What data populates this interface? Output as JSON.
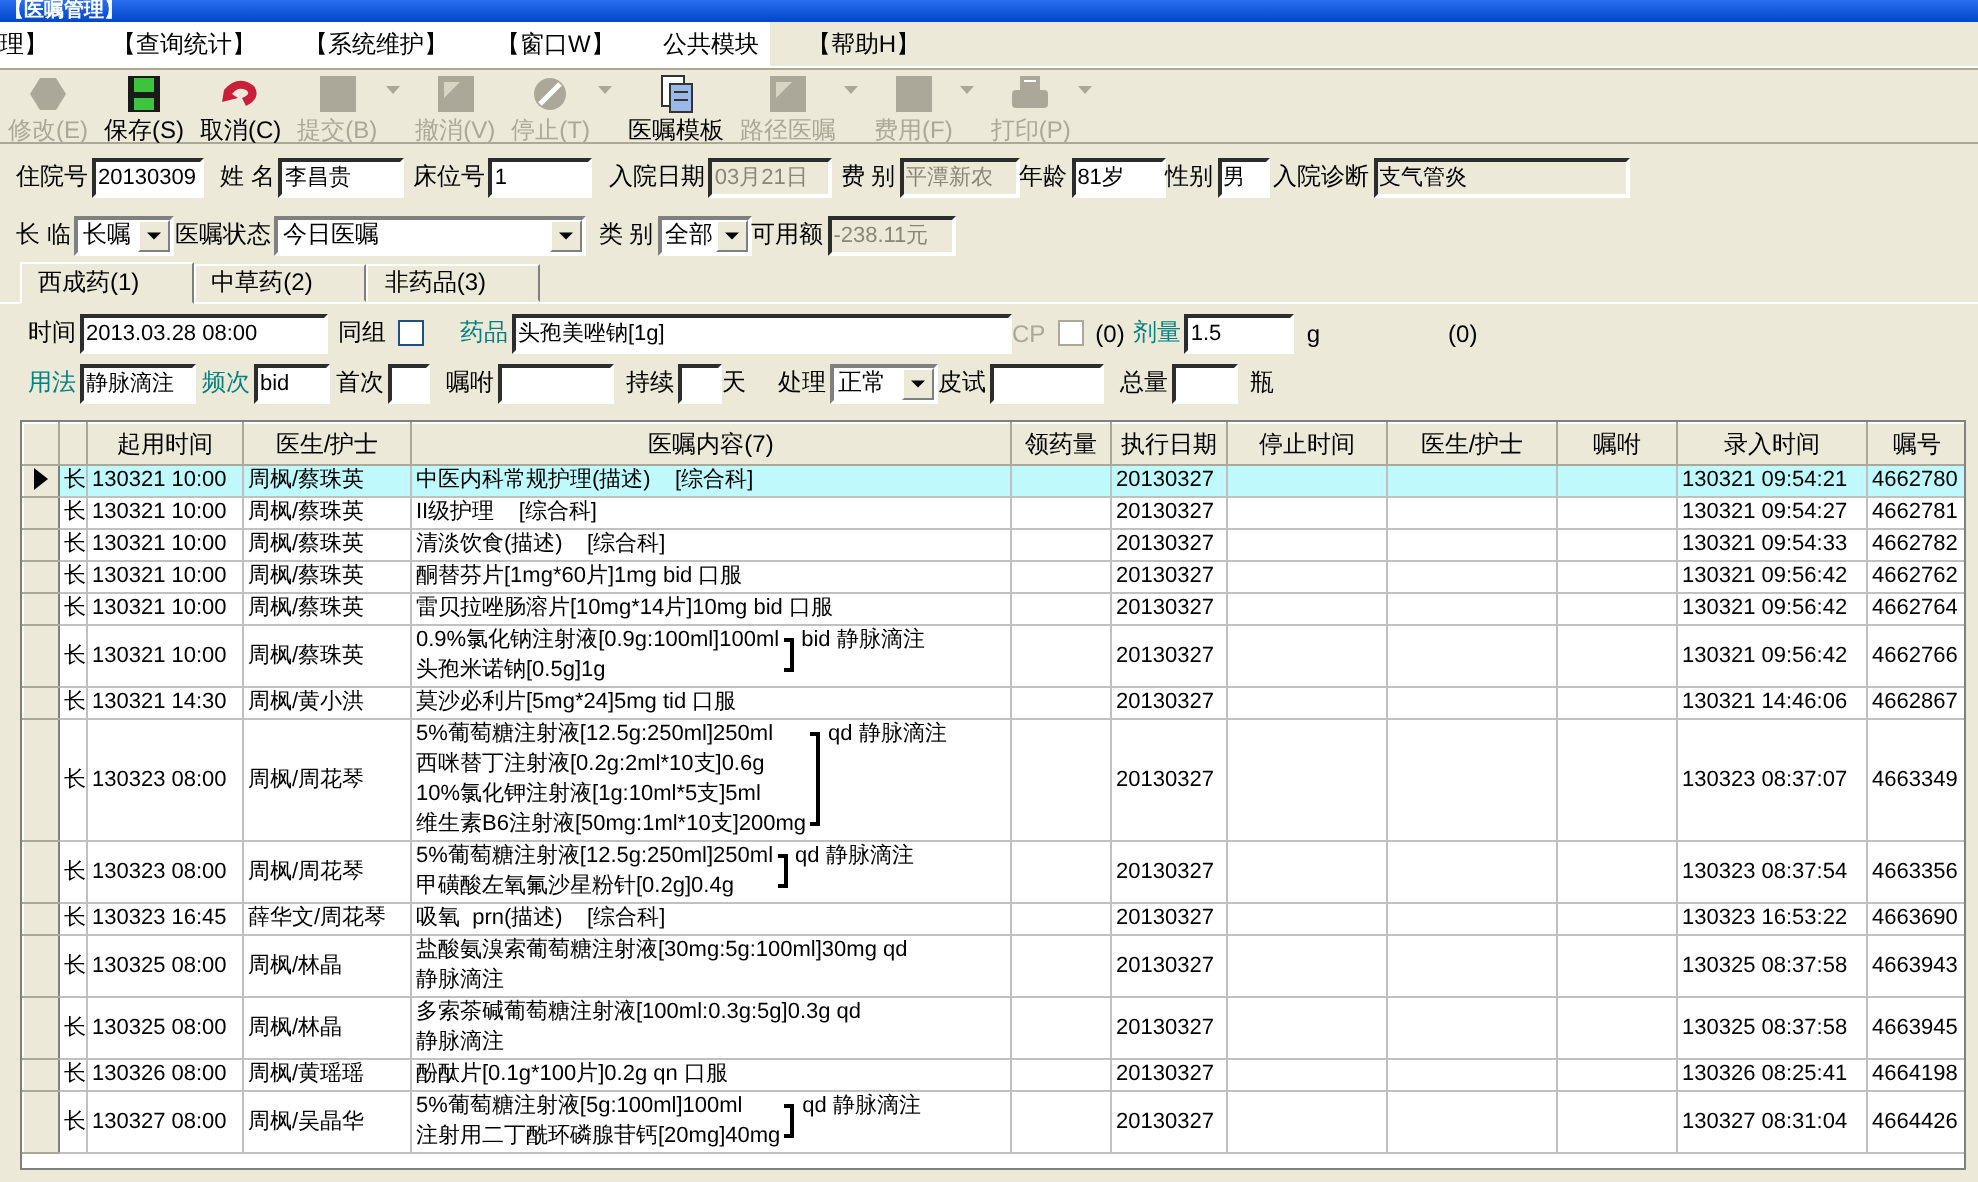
{
  "window": {
    "title": "【医嘱管理】"
  },
  "menu": [
    {
      "label": "理】"
    },
    {
      "label": "【查询统计】"
    },
    {
      "label": "【系统维护】"
    },
    {
      "label": "【窗口W】"
    },
    {
      "label": "公共模块"
    },
    {
      "label": "【帮助H】"
    }
  ],
  "toolbar": [
    {
      "label": "修改(E)",
      "kind": "hexagon",
      "disabled": true,
      "dropdown": false
    },
    {
      "label": "保存(S)",
      "kind": "save",
      "disabled": false,
      "dropdown": false
    },
    {
      "label": "取消(C)",
      "kind": "undo",
      "disabled": false,
      "dropdown": false
    },
    {
      "label": "提交(B)",
      "kind": "square",
      "disabled": true,
      "dropdown": true
    },
    {
      "label": "撤消(V)",
      "kind": "corner",
      "disabled": true,
      "dropdown": false
    },
    {
      "label": "停止(T)",
      "kind": "stop",
      "disabled": true,
      "dropdown": true
    },
    {
      "label": "医嘱模板",
      "kind": "template",
      "disabled": false,
      "dropdown": false
    },
    {
      "label": "路径医嘱",
      "kind": "corner",
      "disabled": true,
      "dropdown": true
    },
    {
      "label": "费用(F)",
      "kind": "square",
      "disabled": true,
      "dropdown": true
    },
    {
      "label": "打印(P)",
      "kind": "print",
      "disabled": true,
      "dropdown": true
    }
  ],
  "patient_fields": [
    {
      "kind": "text",
      "label": "住院号",
      "value": "20130309",
      "disabled": false,
      "readonly": false
    },
    {
      "kind": "text",
      "label": "姓 名",
      "value": "李昌贵",
      "disabled": false,
      "readonly": false
    },
    {
      "kind": "text",
      "label": "床位号",
      "value": "1",
      "disabled": false,
      "readonly": false
    },
    {
      "kind": "text",
      "label": "入院日期",
      "value": "03月21日",
      "disabled": true,
      "readonly": false
    },
    {
      "kind": "text",
      "label": "费 别",
      "value": "平潭新农",
      "disabled": true,
      "readonly": false
    },
    {
      "kind": "text",
      "label": "年龄",
      "value": "81岁",
      "disabled": false,
      "readonly": false
    },
    {
      "kind": "text",
      "label": "性别",
      "value": "男",
      "disabled": false,
      "readonly": false
    },
    {
      "kind": "text",
      "label": "入院诊断",
      "value": "支气管炎",
      "disabled": false,
      "readonly": true
    }
  ],
  "filter_fields": [
    {
      "kind": "select",
      "label": "长 临",
      "value": "长嘱"
    },
    {
      "kind": "select",
      "label": "医嘱状态",
      "value": "今日医嘱"
    },
    {
      "kind": "select",
      "label": "类 别",
      "value": "全部"
    },
    {
      "kind": "text",
      "label": "可用额",
      "value": "-238.11元",
      "disabled": true
    }
  ],
  "tabs": [
    {
      "label": "西成药(1)",
      "selected": true
    },
    {
      "label": "中草药(2)",
      "selected": false
    },
    {
      "label": "非药品(3)",
      "selected": false
    }
  ],
  "order_fields": [
    [
      {
        "kind": "text",
        "label": "时间",
        "value": "2013.03.28 08:00",
        "emphasis": false
      },
      {
        "kind": "check",
        "label": "同组",
        "checked": false,
        "disabled": false
      },
      {
        "kind": "text",
        "label": "药品",
        "value": "头孢美唑钠[1g]",
        "emphasis": true
      },
      {
        "kind": "check",
        "label": "CP",
        "checked": false,
        "disabled": true
      },
      {
        "kind": "note",
        "text": "(0)"
      },
      {
        "kind": "text",
        "label": "剂量",
        "value": "1.5",
        "emphasis": true
      },
      {
        "kind": "note",
        "text": "g"
      },
      {
        "kind": "note",
        "text": "(0)"
      }
    ],
    [
      {
        "kind": "text",
        "label": "用法",
        "value": "静脉滴注",
        "emphasis": true
      },
      {
        "kind": "text",
        "label": "频次",
        "value": "bid",
        "emphasis": true
      },
      {
        "kind": "text",
        "label": "首次",
        "emphasis": false
      },
      {
        "kind": "text",
        "label": "嘱咐",
        "emphasis": false
      },
      {
        "kind": "text",
        "label": "持续",
        "emphasis": false
      },
      {
        "kind": "note",
        "text": "天"
      },
      {
        "kind": "select",
        "label": "处理",
        "value": "正常",
        "emphasis": false
      },
      {
        "kind": "text",
        "label": "皮试",
        "emphasis": false
      },
      {
        "kind": "text",
        "label": "总量",
        "emphasis": false
      },
      {
        "kind": "note",
        "text": "瓶"
      }
    ]
  ],
  "table": {
    "columns": [
      "起用时间",
      "医生/护士",
      "医嘱内容(7)",
      "领药量",
      "执行日期",
      "停止时间",
      "医生/护士",
      "嘱咐",
      "录入时间",
      "嘱号"
    ],
    "rows": [
      {
        "selected": true,
        "type": "长",
        "start": "130321 10:00",
        "staff": "周枫/蔡珠英",
        "content": {
          "kind": "text",
          "lines": [
            "中医内科常规护理(描述)    [综合科]"
          ]
        },
        "exec_date": "20130327",
        "entry_time": "130321 09:54:21",
        "order_no": "4662780"
      },
      {
        "selected": false,
        "type": "长",
        "start": "130321 10:00",
        "staff": "周枫/蔡珠英",
        "content": {
          "kind": "text",
          "lines": [
            "II级护理    [综合科]"
          ]
        },
        "exec_date": "20130327",
        "entry_time": "130321 09:54:27",
        "order_no": "4662781"
      },
      {
        "selected": false,
        "type": "长",
        "start": "130321 10:00",
        "staff": "周枫/蔡珠英",
        "content": {
          "kind": "text",
          "lines": [
            "清淡饮食(描述)    [综合科]"
          ]
        },
        "exec_date": "20130327",
        "entry_time": "130321 09:54:33",
        "order_no": "4662782"
      },
      {
        "selected": false,
        "type": "长",
        "start": "130321 10:00",
        "staff": "周枫/蔡珠英",
        "content": {
          "kind": "text",
          "lines": [
            "酮替芬片[1mg*60片]1mg bid 口服"
          ]
        },
        "exec_date": "20130327",
        "entry_time": "130321 09:56:42",
        "order_no": "4662762"
      },
      {
        "selected": false,
        "type": "长",
        "start": "130321 10:00",
        "staff": "周枫/蔡珠英",
        "content": {
          "kind": "text",
          "lines": [
            "雷贝拉唑肠溶片[10mg*14片]10mg bid 口服"
          ]
        },
        "exec_date": "20130327",
        "entry_time": "130321 09:56:42",
        "order_no": "4662764"
      },
      {
        "selected": false,
        "type": "长",
        "start": "130321 10:00",
        "staff": "周枫/蔡珠英",
        "content": {
          "kind": "group",
          "lines": [
            "0.9%氯化钠注射液[0.9g:100ml]100ml",
            "头孢米诺钠[0.5g]1g"
          ],
          "suffix": "bid 静脉滴注"
        },
        "exec_date": "20130327",
        "entry_time": "130321 09:56:42",
        "order_no": "4662766"
      },
      {
        "selected": false,
        "type": "长",
        "start": "130321 14:30",
        "staff": "周枫/黄小洪",
        "content": {
          "kind": "text",
          "lines": [
            "莫沙必利片[5mg*24]5mg tid 口服"
          ]
        },
        "exec_date": "20130327",
        "entry_time": "130321 14:46:06",
        "order_no": "4662867"
      },
      {
        "selected": false,
        "type": "长",
        "start": "130323 08:00",
        "staff": "周枫/周花琴",
        "content": {
          "kind": "group",
          "lines": [
            "5%葡萄糖注射液[12.5g:250ml]250ml",
            "西咪替丁注射液[0.2g:2ml*10支]0.6g",
            "10%氯化钾注射液[1g:10ml*5支]5ml",
            "维生素B6注射液[50mg:1ml*10支]200mg"
          ],
          "suffix": "qd 静脉滴注"
        },
        "exec_date": "20130327",
        "entry_time": "130323 08:37:07",
        "order_no": "4663349"
      },
      {
        "selected": false,
        "type": "长",
        "start": "130323 08:00",
        "staff": "周枫/周花琴",
        "content": {
          "kind": "group",
          "lines": [
            "5%葡萄糖注射液[12.5g:250ml]250ml",
            "甲磺酸左氧氟沙星粉针[0.2g]0.4g"
          ],
          "suffix": "qd 静脉滴注"
        },
        "exec_date": "20130327",
        "entry_time": "130323 08:37:54",
        "order_no": "4663356"
      },
      {
        "selected": false,
        "type": "长",
        "start": "130323 16:45",
        "staff": "薛华文/周花琴",
        "content": {
          "kind": "text",
          "lines": [
            "吸氧  prn(描述)    [综合科]"
          ]
        },
        "exec_date": "20130327",
        "entry_time": "130323 16:53:22",
        "order_no": "4663690"
      },
      {
        "selected": false,
        "type": "长",
        "start": "130325 08:00",
        "staff": "周枫/林晶",
        "content": {
          "kind": "text",
          "lines": [
            "盐酸氨溴索葡萄糖注射液[30mg:5g:100ml]30mg qd",
            "静脉滴注"
          ]
        },
        "exec_date": "20130327",
        "entry_time": "130325 08:37:58",
        "order_no": "4663943"
      },
      {
        "selected": false,
        "type": "长",
        "start": "130325 08:00",
        "staff": "周枫/林晶",
        "content": {
          "kind": "text",
          "lines": [
            "多索茶碱葡萄糖注射液[100ml:0.3g:5g]0.3g qd",
            "静脉滴注"
          ]
        },
        "exec_date": "20130327",
        "entry_time": "130325 08:37:58",
        "order_no": "4663945"
      },
      {
        "selected": false,
        "type": "长",
        "start": "130326 08:00",
        "staff": "周枫/黄瑶瑶",
        "content": {
          "kind": "text",
          "lines": [
            "酚酞片[0.1g*100片]0.2g qn 口服"
          ]
        },
        "exec_date": "20130327",
        "entry_time": "130326 08:25:41",
        "order_no": "4664198"
      },
      {
        "selected": false,
        "type": "长",
        "start": "130327 08:00",
        "staff": "周枫/吴晶华",
        "content": {
          "kind": "group",
          "lines": [
            "5%葡萄糖注射液[5g:100ml]100ml",
            "注射用二丁酰环磷腺苷钙[20mg]40mg"
          ],
          "suffix": "qd 静脉滴注"
        },
        "exec_date": "20130327",
        "entry_time": "130327 08:31:04",
        "order_no": "4664426"
      }
    ]
  }
}
